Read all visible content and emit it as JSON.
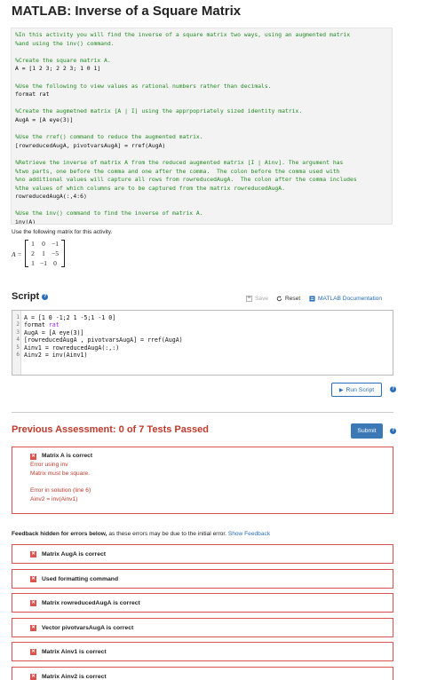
{
  "page": {
    "title": "MATLAB: Inverse of a Square Matrix"
  },
  "example_code": {
    "lines": [
      {
        "t": "%In this activity you will find the inverse of a square matrix two ways, using an augmented matrix",
        "c": true
      },
      {
        "t": "%and using the inv() command.",
        "c": true
      },
      {
        "t": "",
        "c": false
      },
      {
        "t": "%Create the square matrix A.",
        "c": true
      },
      {
        "t": "A = [1 2 3; 2 2 3; 1 0 1]",
        "c": false
      },
      {
        "t": "",
        "c": false
      },
      {
        "t": "%Use the following to view values as rational numbers rather than decimals.",
        "c": true
      },
      {
        "t": "format rat",
        "c": false
      },
      {
        "t": "",
        "c": false
      },
      {
        "t": "%Create the augmetned matrix [A | I] using the apprpopriately sized identity matrix.",
        "c": true
      },
      {
        "t": "AugA = [A eye(3)]",
        "c": false
      },
      {
        "t": "",
        "c": false
      },
      {
        "t": "%Use the rref() command to reduce the augmented matrix.",
        "c": true
      },
      {
        "t": "[rowreducedAugA, pivotvarsAugA] = rref(AugA)",
        "c": false
      },
      {
        "t": "",
        "c": false
      },
      {
        "t": "%Retrieve the inverse of matrix A from the reduced augmented matrix [I | Ainv]. The argument has",
        "c": true
      },
      {
        "t": "%two parts, one before the comma and one after the comma.  The colon before the comma used with",
        "c": true
      },
      {
        "t": "%no additional values will capture all rows from rowreducedAugA.  The colon after the comma includes",
        "c": true
      },
      {
        "t": "%the values of which columns are to be captured from the matrix rowreducedAugA.",
        "c": true
      },
      {
        "t": "rowreducedAugA(:,4:6)",
        "c": false
      },
      {
        "t": "",
        "c": false
      },
      {
        "t": "%Use the inv() command to find the inverse of matrix A.",
        "c": true
      },
      {
        "t": "inv(A)",
        "c": false
      }
    ]
  },
  "matrix_section": {
    "instruction": "Use the following matrix for this activity.",
    "label": "A =",
    "rows": [
      [
        "1",
        "0",
        "−1"
      ],
      [
        "2",
        "1",
        "−5"
      ],
      [
        "1",
        "−1",
        "0"
      ]
    ]
  },
  "script": {
    "title": "Script",
    "save_label": "Save",
    "reset_label": "Reset",
    "doc_label": "MATLAB Documentation",
    "line_numbers": [
      "1",
      "2",
      "3",
      "4",
      "5",
      "6"
    ],
    "lines": [
      "A = [1 0 -1;2 1 -5;1 -1 0]",
      "format rat",
      "AugA = [A eye(3)]",
      "[rowreducedAugA , pivotvarsAugA] = rref(AugA)",
      "Ainv1 = rowreducedAugA(:,:)",
      "Ainv2 = inv(Ainv1)"
    ],
    "run_label": "Run Script"
  },
  "assessment": {
    "title": "Previous Assessment: 0 of 7 Tests Passed",
    "submit_label": "Submit",
    "first_test": {
      "name": "Matrix A is correct",
      "error1": "Error using inv",
      "error2": "Matrix must be square.",
      "error3": "Error in solution (line 6)",
      "error4": "Ainv2 = inv(Ainv1)"
    },
    "feedback_bold": "Feedback hidden for errors below,",
    "feedback_rest": " as these errors may be due to the initial error. ",
    "feedback_link": "Show Feedback",
    "tests": [
      "Matrix AugA is correct",
      "Used formatting command",
      "Matrix rowreducedAugA is correct",
      "Vector pivotvarsAugA is correct",
      "Matrix Ainv1 is correct",
      "Matrix Ainv2 is correct"
    ]
  },
  "colors": {
    "accent": "#2a6ebb",
    "error": "#d9534f",
    "comment": "#228b22",
    "submit": "#3a78b6"
  }
}
